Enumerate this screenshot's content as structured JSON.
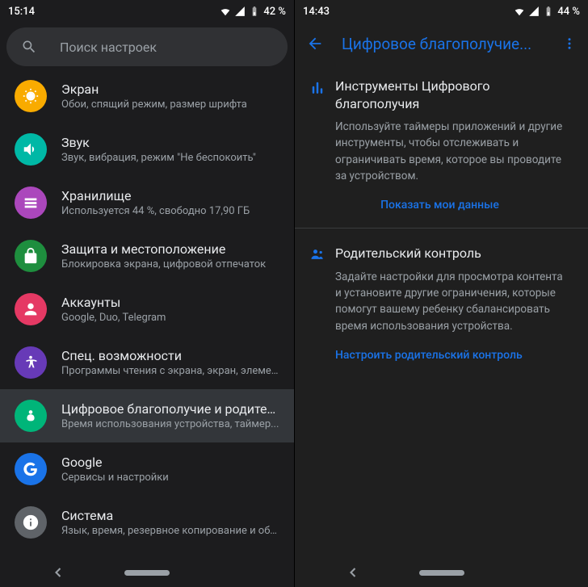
{
  "left": {
    "status": {
      "time": "15:14",
      "battery": "42 %"
    },
    "search": {
      "placeholder": "Поиск настроек"
    },
    "items": [
      {
        "title": "Экран",
        "sub": "Обои, спящий режим, размер шрифта",
        "color": "#f9ab00"
      },
      {
        "title": "Звук",
        "sub": "Звук, вибрация, режим \"Не беспокоить\"",
        "color": "#00b8a6"
      },
      {
        "title": "Хранилище",
        "sub": "Используется 44 %, свободно 17,90 ГБ",
        "color": "#ab47bc"
      },
      {
        "title": "Защита и местоположение",
        "sub": "Блокировка экрана, цифровой отпечаток",
        "color": "#1e8e3e"
      },
      {
        "title": "Аккаунты",
        "sub": "Google, Duo, Telegram",
        "color": "#e53964"
      },
      {
        "title": "Спец. возможности",
        "sub": "Программы чтения с экрана, экран, элемен...",
        "color": "#673ab7"
      },
      {
        "title": "Цифровое благополучие и родительский..",
        "sub": "Время использования устройства, таймер...",
        "color": "#00b579",
        "selected": true
      },
      {
        "title": "Google",
        "sub": "Сервисы и настройки",
        "color": "#1a73e8"
      },
      {
        "title": "Система",
        "sub": "Язык, время, резервное копирование и обн...",
        "color": "#5f6368"
      }
    ]
  },
  "right": {
    "status": {
      "time": "14:43",
      "battery": "44 %"
    },
    "header": {
      "title": "Цифровое благополучие..."
    },
    "sections": [
      {
        "title": "Инструменты Цифрового благополучия",
        "desc": "Используйте таймеры приложений и другие инструменты, чтобы отслеживать и ограничивать время, которое вы проводите за устройством.",
        "link": "Показать мои данные"
      },
      {
        "title": "Родительский контроль",
        "desc": "Задайте настройки для просмотра контента и установите другие ограничения, которые помогут вашему ребенку сбалансировать время использования устройства.",
        "link": "Настроить родительский контроль"
      }
    ]
  }
}
